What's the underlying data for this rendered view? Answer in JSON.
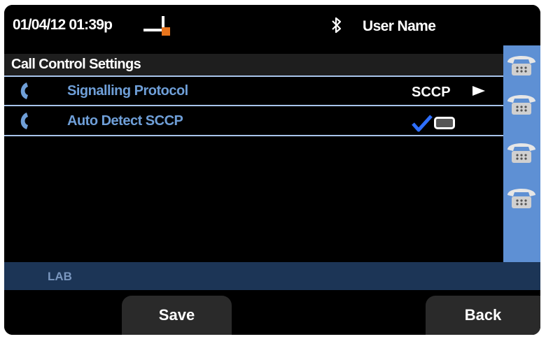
{
  "status": {
    "datetime": "01/04/12 01:39p",
    "username": "User Name",
    "icons": [
      "off-hook-phone-icon",
      "bluetooth-icon"
    ],
    "accent_orange": "#e8741c"
  },
  "menu": {
    "title": "Call Control Settings",
    "items": [
      {
        "label": "Signalling Protocol",
        "value": "SCCP",
        "icon": "phone-handset-icon",
        "trailing_icon": "arrow-right-icon"
      },
      {
        "label": "Auto Detect SCCP",
        "checked": true,
        "icon": "phone-handset-icon",
        "trailing_icon": "checkbox-checked-icon"
      }
    ]
  },
  "line_keys": [
    {
      "icon": "line-phone-icon"
    },
    {
      "icon": "line-phone-icon"
    },
    {
      "icon": "line-phone-icon"
    },
    {
      "icon": "line-phone-icon"
    }
  ],
  "label_bar": {
    "text": "LAB"
  },
  "softkeys": {
    "left": "Save",
    "right": "Back"
  },
  "colors": {
    "item_text": "#6f9fd8",
    "separator": "#a8c4ea",
    "sidebar": "#5e90d4",
    "label_bar": "#1c3556"
  }
}
